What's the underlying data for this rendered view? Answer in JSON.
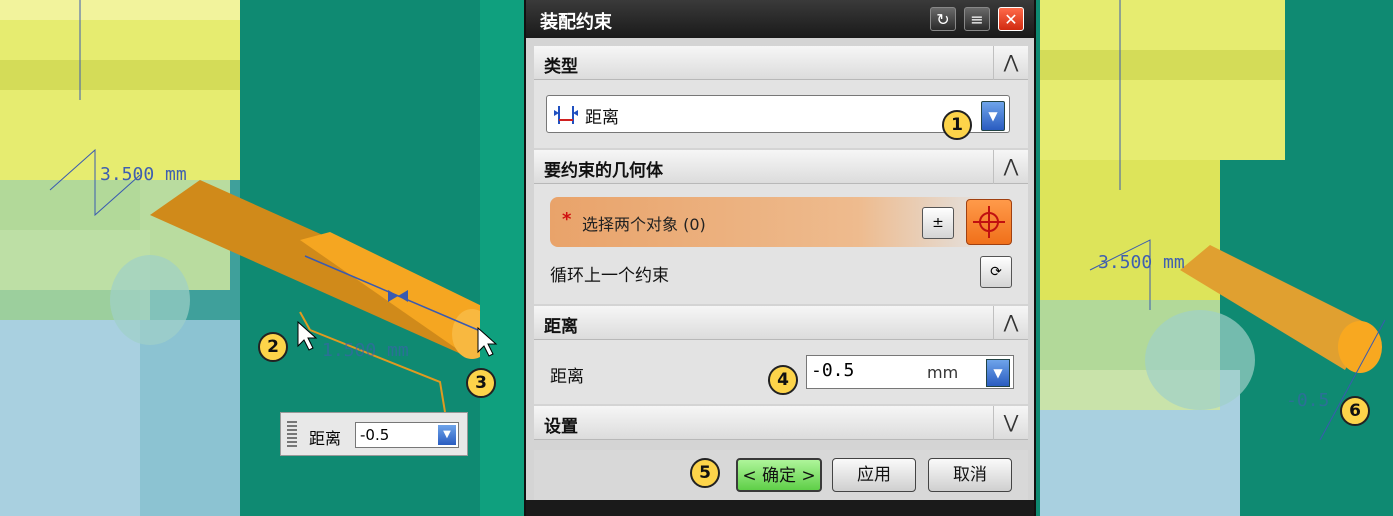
{
  "dialog": {
    "title": "装配约束",
    "title_buttons": [
      "reset-icon",
      "menu-icon",
      "close-icon"
    ],
    "sections": {
      "type": {
        "label": "类型",
        "selected": "距离",
        "chevron": "⋀"
      },
      "geometry": {
        "label": "要约束的几何体",
        "chevron": "⋀",
        "select_label": "选择两个对象 (0)",
        "cycle_label": "循环上一个约束"
      },
      "distance": {
        "label": "距离",
        "chevron": "⋀",
        "field_label": "距离",
        "value": "-0.5",
        "unit": "mm"
      },
      "settings": {
        "label": "设置",
        "chevron": "⋁"
      }
    },
    "buttons": {
      "ok": "< 确定 >",
      "apply": "应用",
      "cancel": "取消"
    }
  },
  "viewport_left": {
    "dim_top": "3.500 mm",
    "dim_bottom": "1.500 mm",
    "widget": {
      "label": "距离",
      "value": "-0.5"
    }
  },
  "viewport_right": {
    "dim_top": "3.500 mm",
    "dim_bottom": "-0.5"
  },
  "callouts": [
    "1",
    "2",
    "3",
    "4",
    "5",
    "6"
  ],
  "colors": {
    "accent_orange": "#f0a020",
    "ok_green": "#5fcf48",
    "background": "#0f8a72"
  }
}
